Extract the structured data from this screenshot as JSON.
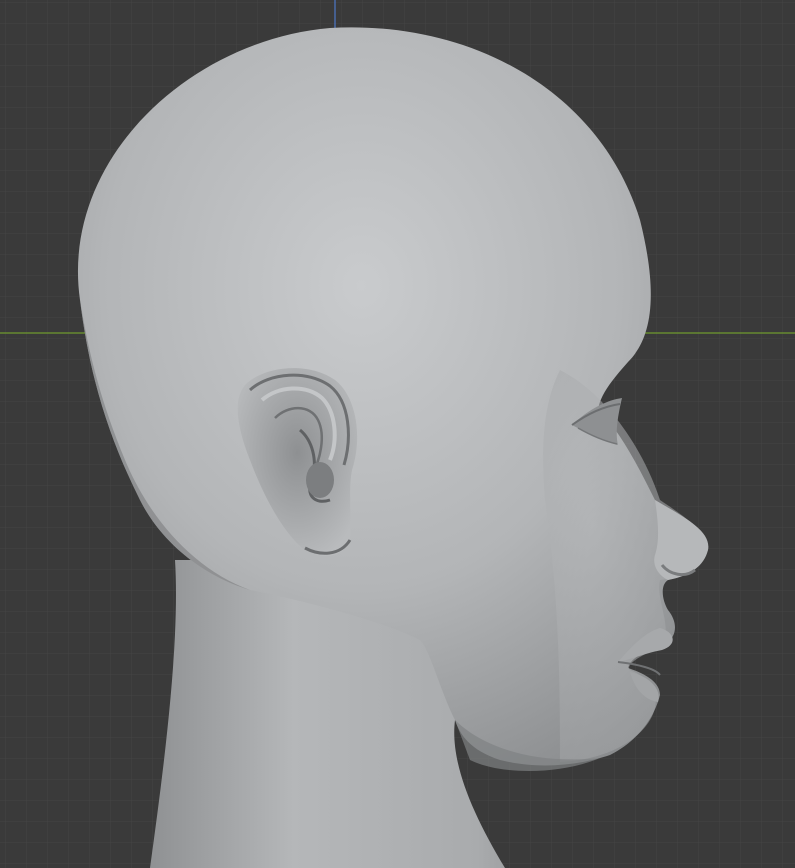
{
  "viewport": {
    "view": "side",
    "background_color": "#3a3a3a",
    "grid": {
      "visible": true,
      "minor_color": "#424242",
      "major_color": "#4b4b4b",
      "x_axis_color": "#6f9a2e",
      "y_axis_color": "#4d78c8"
    },
    "model": {
      "object": "sculpted-head",
      "material_color": "#b4b6b8",
      "shading": "solid-matcap-grey"
    }
  }
}
